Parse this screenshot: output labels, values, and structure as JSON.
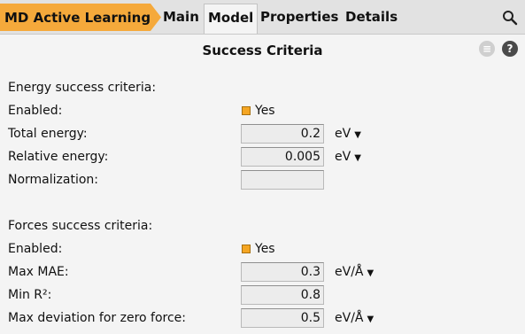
{
  "header": {
    "app_title": "MD Active Learning",
    "tabs": [
      {
        "label": "Main"
      },
      {
        "label": "Model"
      },
      {
        "label": "Properties"
      },
      {
        "label": "Details"
      }
    ]
  },
  "panel": {
    "title": "Success Criteria",
    "menu_icon_glyph": "≡",
    "help_icon_glyph": "?"
  },
  "energy": {
    "section_label": "Energy success criteria:",
    "enabled_label": "Enabled:",
    "enabled_value": "Yes",
    "total_energy_label": "Total energy:",
    "total_energy_value": "0.2",
    "total_energy_unit": "eV",
    "relative_energy_label": "Relative energy:",
    "relative_energy_value": "0.005",
    "relative_energy_unit": "eV",
    "normalization_label": "Normalization:",
    "normalization_value": ""
  },
  "forces": {
    "section_label": "Forces success criteria:",
    "enabled_label": "Enabled:",
    "enabled_value": "Yes",
    "max_mae_label": "Max MAE:",
    "max_mae_value": "0.3",
    "max_mae_unit": "eV/Å",
    "min_r2_label": "Min R²:",
    "min_r2_value": "0.8",
    "max_dev_label": "Max deviation for zero force:",
    "max_dev_value": "0.5",
    "max_dev_unit": "eV/Å"
  },
  "dropdown_glyph": "▼",
  "colors": {
    "accent": "#f5a93b",
    "checkbox": "#f5a623",
    "topbar": "#e2e2e2",
    "background": "#f4f4f4"
  }
}
